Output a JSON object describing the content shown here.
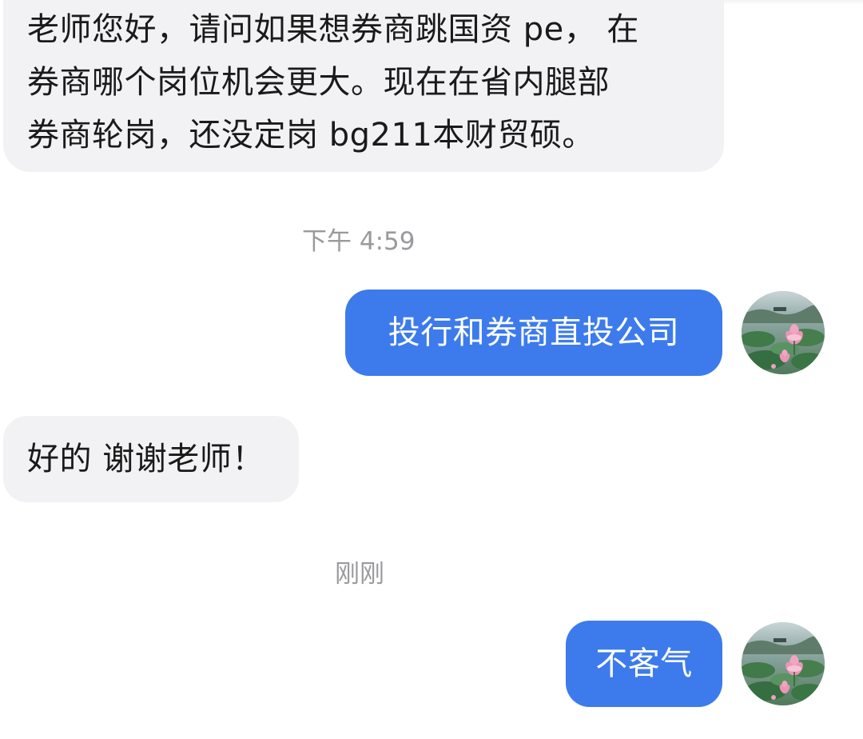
{
  "messages": {
    "incoming_1": {
      "lines": [
        "老师您好，请问如果想券商跳国资 pe， 在",
        "券商哪个岗位机会更大。现在在省内腿部",
        "券商轮岗，还没定岗 bg211本财贸硕。"
      ]
    },
    "timestamp_1": "下午 4:59",
    "outgoing_1": "投行和券商直投公司",
    "incoming_2": "好的 谢谢老师！",
    "timestamp_2": "刚刚",
    "outgoing_2": "不客气"
  },
  "avatar": {
    "icon": "lotus-pond-avatar-icon"
  },
  "colors": {
    "outgoing_bubble": "#3d7bec",
    "incoming_bubble": "#f2f2f4",
    "timestamp_text": "#9a9a9e"
  }
}
